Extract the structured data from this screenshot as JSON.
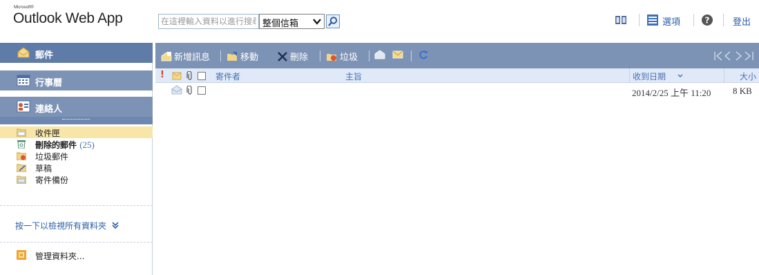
{
  "header": {
    "brand_small": "Microsoft®",
    "brand": "Outlook Web App",
    "search": {
      "placeholder": "在這裡輸入資料以進行搜尋",
      "scope": "整個信箱"
    },
    "links": {
      "options": "選項",
      "signout": "登出"
    }
  },
  "nav": {
    "mail": "郵件",
    "calendar": "行事曆",
    "contacts": "連絡人"
  },
  "folders": [
    {
      "name": "收件匣",
      "count": ""
    },
    {
      "name": "刪除的郵件",
      "count": "(25)"
    },
    {
      "name": "垃圾郵件",
      "count": ""
    },
    {
      "name": "草稿",
      "count": ""
    },
    {
      "name": "寄件備份",
      "count": ""
    }
  ],
  "show_all_folders": "按一下以檢視所有資料夾",
  "manage_folders": "管理資料夾...",
  "toolbar": {
    "new": "新增訊息",
    "move": "移動",
    "delete": "刪除",
    "junk": "垃圾"
  },
  "columns": {
    "from": "寄件者",
    "subject": "主旨",
    "received": "收到日期",
    "size": "大小"
  },
  "messages": [
    {
      "from": "",
      "subject": "",
      "received": "2014/2/25 上午 11:20",
      "size": "8 KB"
    }
  ],
  "colors": {
    "nav_active": "#5f7ca8",
    "nav": "#7d93b6",
    "selected_folder": "#f8e6a8",
    "link": "#2a5ca8",
    "column_header": "#dfe9f7"
  }
}
